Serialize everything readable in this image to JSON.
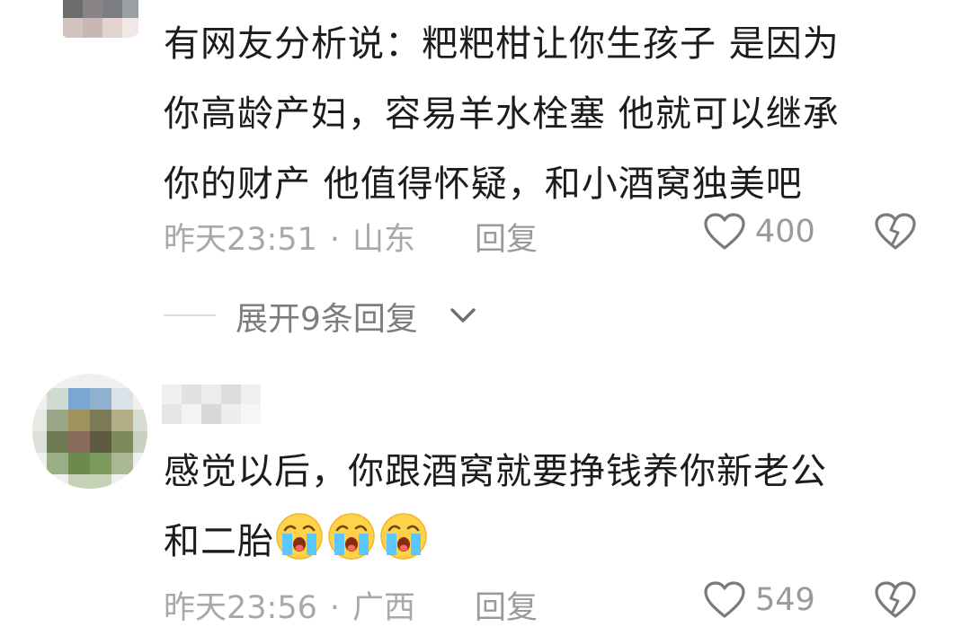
{
  "comments": [
    {
      "username": "",
      "lines": [
        "有网友分析说：粑粑柑让你生孩子 是因为",
        "你高龄产妇，容易羊水栓塞 他就可以继承",
        "你的财产 他值得怀疑，和小酒窝独美吧"
      ],
      "time": "昨天23:51",
      "location": "山东",
      "reply_label": "回复",
      "like_count": "400",
      "expand_label": "展开9条回复"
    },
    {
      "username": "",
      "lines": [
        "感觉以后，你跟酒窝就要挣钱养你新老公",
        "和二胎"
      ],
      "emojis": [
        "crying-emoji",
        "crying-emoji",
        "crying-emoji"
      ],
      "time": "昨天23:56",
      "location": "广西",
      "reply_label": "回复",
      "like_count": "549"
    }
  ],
  "meta_separator": "·",
  "colors": {
    "text": "#1c1c1c",
    "meta": "#a8a8a8",
    "divider": "#dedede"
  }
}
